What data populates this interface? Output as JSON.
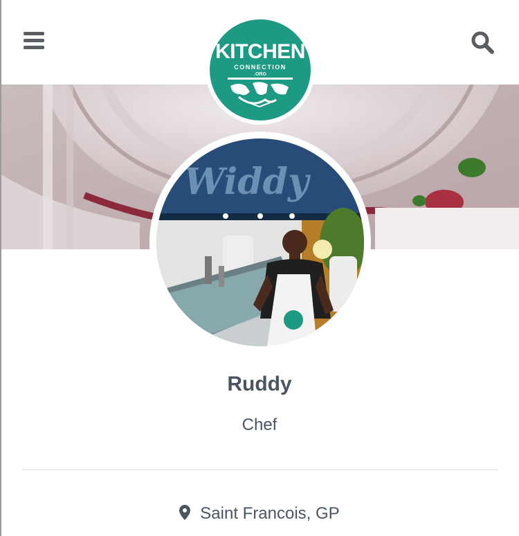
{
  "header": {
    "menu_icon": "hamburger-menu-icon",
    "search_icon": "search-icon",
    "logo": {
      "line1": "KITCHEN",
      "line2": "CONNECTION",
      "line3": ".ORG"
    }
  },
  "profile": {
    "name": "Ruddy",
    "role": "Chef",
    "location": "Saint Francois, GP",
    "location_icon": "map-pin-icon"
  },
  "colors": {
    "brand": "#1d9a84",
    "text": "#4a5561",
    "icon": "#5a5e62"
  }
}
